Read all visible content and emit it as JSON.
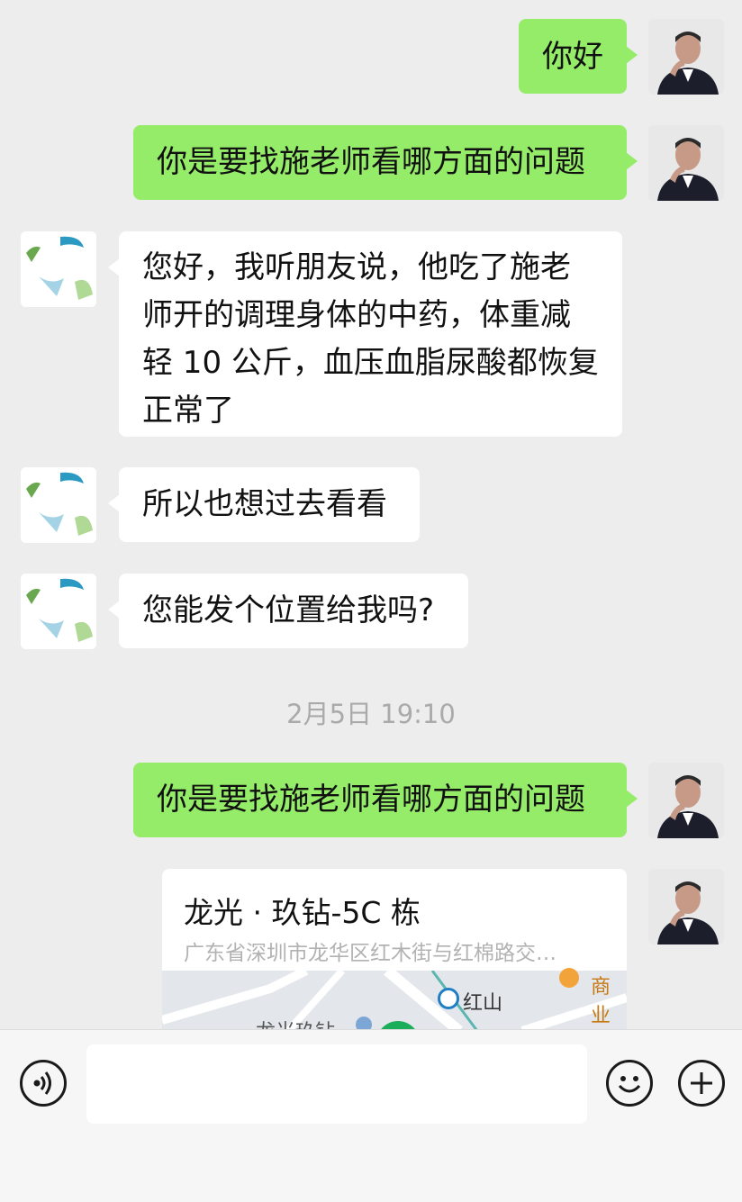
{
  "messages": [
    {
      "side": "me",
      "text": "你好"
    },
    {
      "side": "me",
      "text": "你是要找施老师看哪方面的问题"
    },
    {
      "side": "other",
      "lines": [
        "您好，我听朋友说，他吃了施老",
        "师开的调理身体的中药，体重减",
        "轻 10 公斤，血压血脂尿酸都恢复",
        "正常了"
      ]
    },
    {
      "side": "other",
      "text": "所以也想过去看看"
    },
    {
      "side": "other",
      "text": "您能发个位置给我吗?"
    },
    {
      "side": "me",
      "text": "你是要找施老师看哪方面的问题"
    }
  ],
  "timestamp": "2月5日 19:10",
  "location": {
    "title": "龙光 · 玖钻-5C 栋",
    "address": "广东省深圳市龙华区红木街与红棉路交…",
    "map_labels": {
      "station": "红山",
      "poi": "商业",
      "place": "龙光玖钻"
    }
  },
  "input_bar": {
    "voice_icon": "voice-icon",
    "emoji_icon": "emoji-icon",
    "plus_icon": "plus-icon"
  },
  "colors": {
    "my_bubble": "#95ec69",
    "background": "#ededed"
  }
}
